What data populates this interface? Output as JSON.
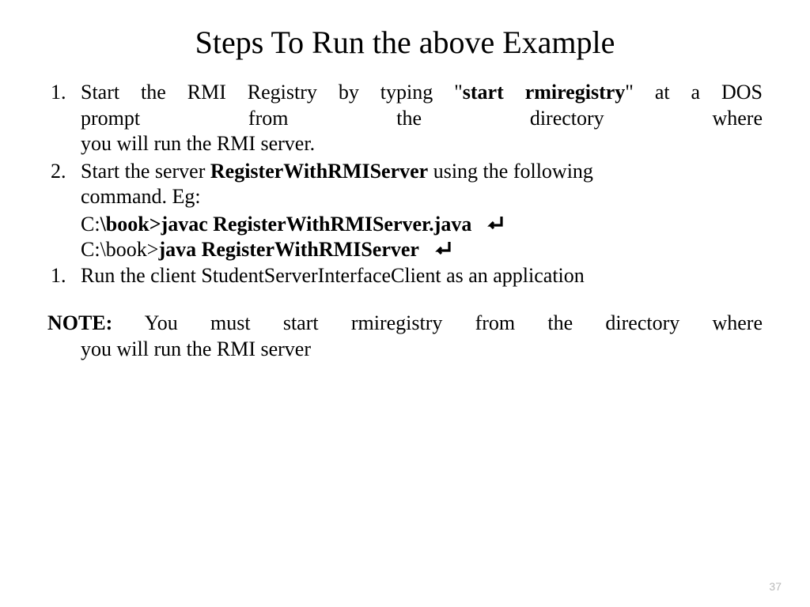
{
  "title": "Steps To Run the above Example",
  "items": {
    "i1": {
      "num": "1.",
      "l1a": "Start the RMI Registry by typing \"",
      "l1b": "start rmiregistry",
      "l1c": "\" at a DOS",
      "l2": "prompt from the directory where",
      "l3": "you will run the RMI server."
    },
    "i2": {
      "num": "2.",
      "l1a": "Start the server ",
      "l1b": "RegisterWithRMIServer",
      "l1c": " using the following",
      "l2": "command. Eg:",
      "cmd1a": "C:",
      "cmd1b": "\\book>javac RegisterWithRMIServer.java",
      "cmd2a": " C:\\book>",
      "cmd2b": "java RegisterWithRMIServer"
    },
    "i3": {
      "num": "1.",
      "text": "Run the client StudentServerInterfaceClient as an application"
    }
  },
  "note": {
    "label": "NOTE:",
    "l1": " You must start rmiregistry from the directory where",
    "l2": "you will run the RMI server"
  },
  "page": "37",
  "icons": {
    "enter": "enter-key-icon"
  }
}
